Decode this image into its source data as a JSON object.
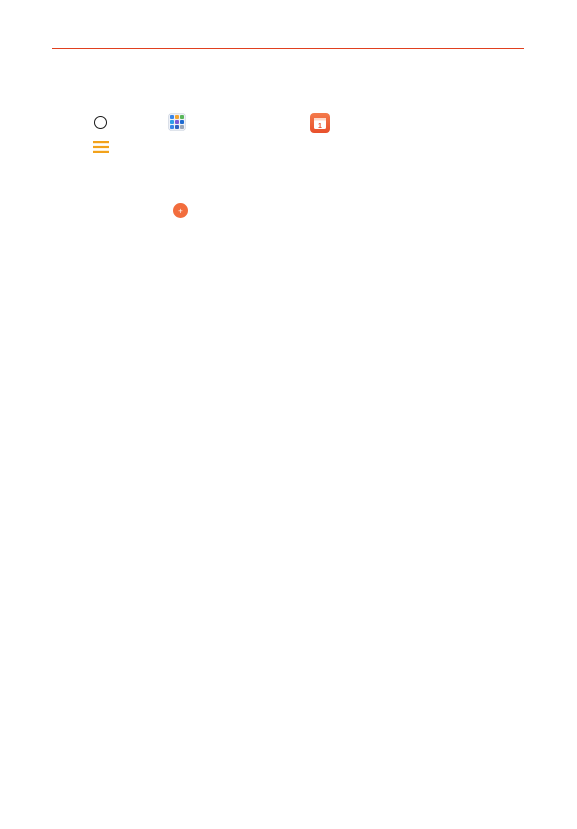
{
  "document": {
    "accent_color": "#e0401f",
    "icons": {
      "home": "home-circle-icon",
      "apps": "apps-grid-icon",
      "calendar": "calendar-icon",
      "menu": "menu-icon",
      "add": "add-plus-icon"
    },
    "calendar_day": "1",
    "add_symbol": "+"
  }
}
